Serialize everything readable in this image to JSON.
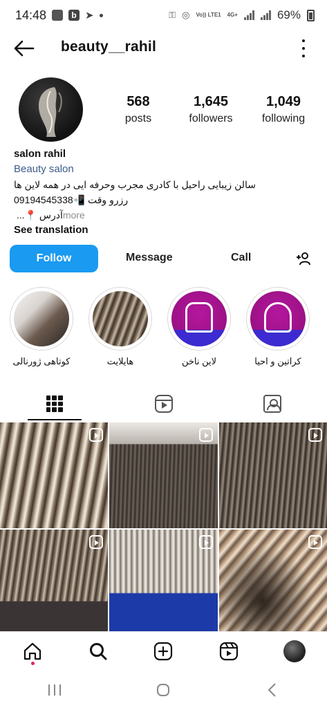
{
  "status_bar": {
    "time": "14:48",
    "battery": "69%",
    "network": "4G+",
    "volte": "Vo)) LTE1"
  },
  "header": {
    "username": "beauty__rahil"
  },
  "profile": {
    "stats": [
      {
        "value": "568",
        "label": "posts"
      },
      {
        "value": "1,645",
        "label": "followers"
      },
      {
        "value": "1,049",
        "label": "following"
      }
    ],
    "name": "salon rahil",
    "category": "Beauty salon",
    "bio_line1": "سالن زیبایی راحیل با کادری مجرب وحرفه ایی در همه لاین ها",
    "bio_line2": "رزرو وقت 📲09194545338",
    "bio_line3_prefix": "آدرس 📍... ",
    "bio_more": "more",
    "see_translation": "See translation"
  },
  "actions": {
    "follow": "Follow",
    "message": "Message",
    "call": "Call"
  },
  "highlights": [
    {
      "label": "کوتاهی ژورنالی"
    },
    {
      "label": "هایلایت"
    },
    {
      "label": "لاین ناخن"
    },
    {
      "label": "کراتین و احیا"
    }
  ],
  "colors": {
    "follow_button": "#1a9af0",
    "category_text": "#3b5b8a",
    "notification_dot": "#e0245e",
    "highlight_icon_bg": "#b5179e"
  }
}
